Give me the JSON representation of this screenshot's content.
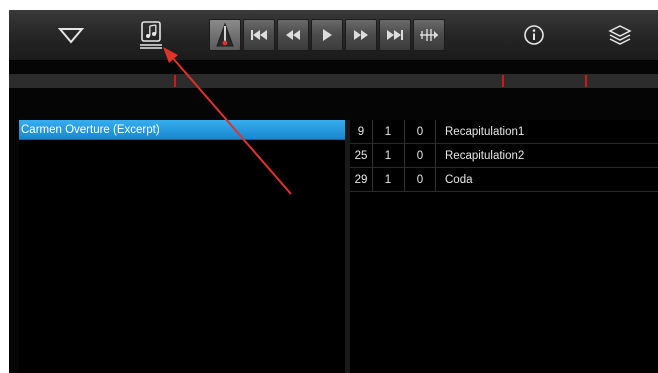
{
  "toolbar": {
    "icons": [
      "triangle-down-icon",
      "score-icon",
      "metronome-icon",
      "skip-to-start-icon",
      "rewind-icon",
      "play-icon",
      "fast-forward-icon",
      "skip-to-end-icon",
      "loop-icon",
      "info-icon",
      "layers-icon"
    ]
  },
  "song_list": {
    "selected_title": "Carmen Overture (Excerpt)"
  },
  "markers": [
    {
      "bar": "9",
      "beat": "1",
      "tick": "0",
      "name": "Recapitulation1"
    },
    {
      "bar": "25",
      "beat": "1",
      "tick": "0",
      "name": "Recapitulation2"
    },
    {
      "bar": "29",
      "beat": "1",
      "tick": "0",
      "name": "Coda"
    }
  ],
  "colors": {
    "selection": "#1f8fd6",
    "marker_line": "#d01818",
    "annotation_arrow": "#e0332a"
  }
}
